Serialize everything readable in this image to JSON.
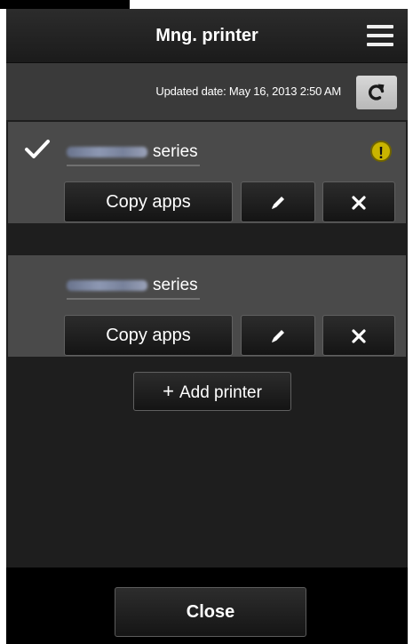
{
  "header": {
    "title": "Mng. printer",
    "menu_icon": "hamburger-menu-icon"
  },
  "status": {
    "updated_text": "Updated date: May 16, 2013 2:50 AM",
    "refresh_icon": "refresh-icon"
  },
  "printers": [
    {
      "name_suffix": "series",
      "selected": true,
      "has_warning": true,
      "warning_symbol": "!",
      "copy_label": "Copy apps",
      "edit_icon": "pencil-icon",
      "delete_icon": "close-icon"
    },
    {
      "name_suffix": "series",
      "selected": false,
      "has_warning": false,
      "copy_label": "Copy apps",
      "edit_icon": "pencil-icon",
      "delete_icon": "close-icon"
    }
  ],
  "add_printer": {
    "plus": "+",
    "label": "Add printer"
  },
  "footer": {
    "close_label": "Close"
  },
  "colors": {
    "background": "#1e1e1e",
    "card": "#4a4a4a",
    "status_bar": "#3a3a3a",
    "warning": "#c9b400",
    "text": "#ffffff"
  }
}
